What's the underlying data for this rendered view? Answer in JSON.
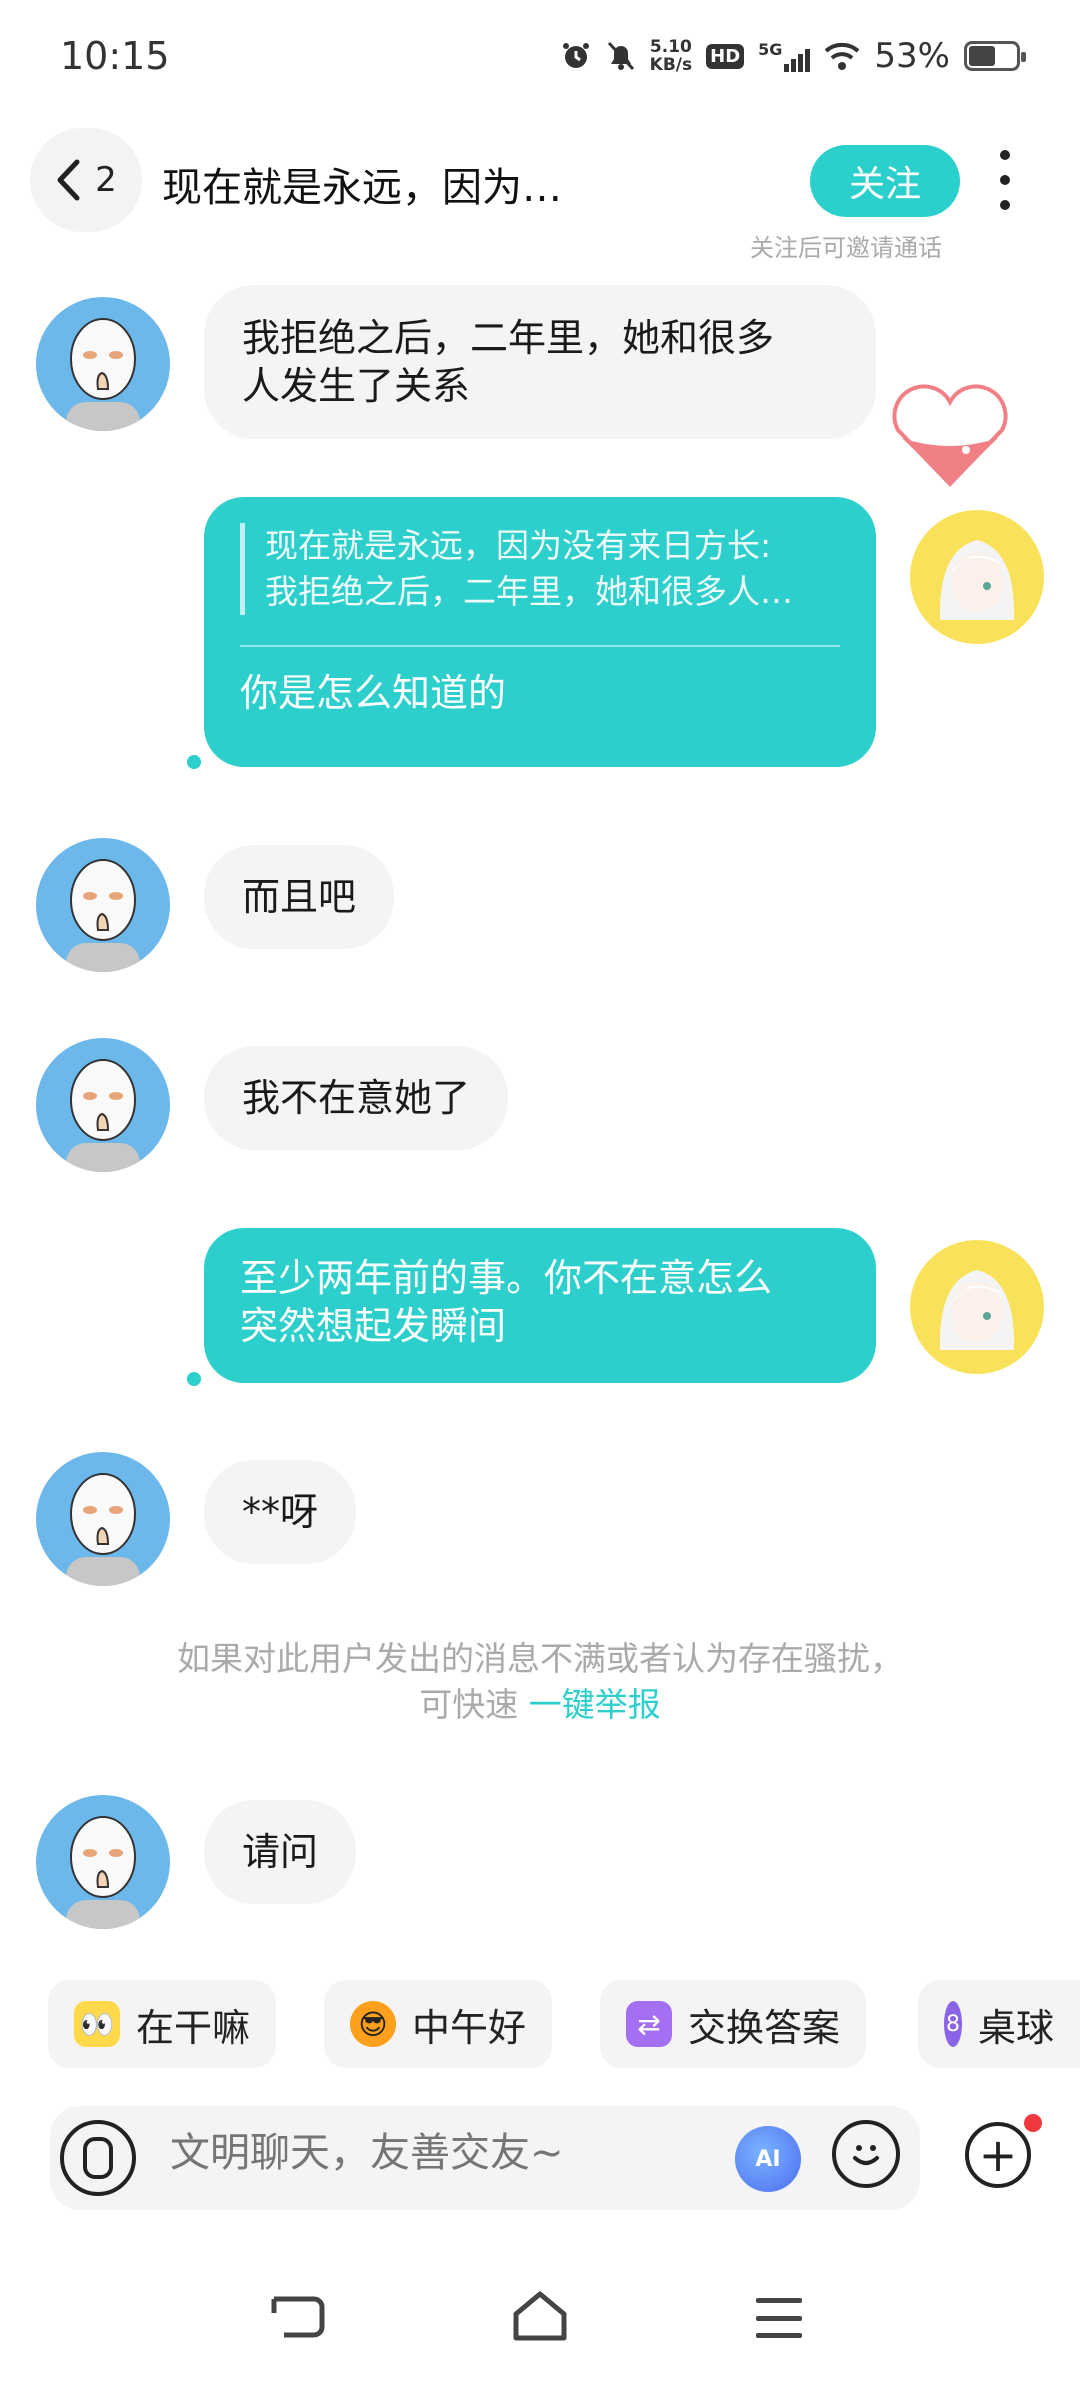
{
  "status_bar": {
    "time": "10:15",
    "net_speed_value": "5.10",
    "net_speed_unit": "KB/s",
    "hd_label": "HD",
    "network": "5G",
    "battery_percent": "53%"
  },
  "header": {
    "back_count": "2",
    "title": "现在就是永远，因为…",
    "follow_label": "关注",
    "follow_tip": "关注后可邀请通话"
  },
  "messages": [
    {
      "side": "in",
      "text_line1": "我拒绝之后，二年里，她和很多",
      "text_line2": "人发生了关系"
    },
    {
      "side": "out",
      "quote_line1": "现在就是永远，因为没有来日方长:",
      "quote_line2": "我拒绝之后，二年里，她和很多人…",
      "text": "你是怎么知道的"
    },
    {
      "side": "in",
      "text": "而且吧"
    },
    {
      "side": "in",
      "text": "我不在意她了"
    },
    {
      "side": "out",
      "text_line1": "至少两年前的事。你不在意怎么",
      "text_line2": "突然想起发瞬间"
    },
    {
      "side": "in",
      "text": "**呀"
    },
    {
      "side": "in",
      "text": "请问"
    }
  ],
  "notice": {
    "line1": "如果对此用户发出的消息不满或者认为存在骚扰，",
    "line2_prefix": "可快速 ",
    "link": "一键举报"
  },
  "quick_replies": [
    {
      "label": "在干嘛",
      "icon": "peeking-emoji-icon"
    },
    {
      "label": "中午好",
      "icon": "sun-sunglasses-icon"
    },
    {
      "label": "交换答案",
      "icon": "swap-icon"
    },
    {
      "label": "桌球",
      "icon": "billiard-ball-icon",
      "badge": "8"
    }
  ],
  "input": {
    "placeholder": "文明聊天，友善交友~",
    "ai_label": "AI"
  },
  "colors": {
    "accent": "#2ccfcb",
    "incoming_bubble": "#f4f4f4",
    "left_avatar_bg": "#6cb8ea",
    "right_avatar_bg": "#f9e25a",
    "notification_dot": "#f0383e"
  }
}
